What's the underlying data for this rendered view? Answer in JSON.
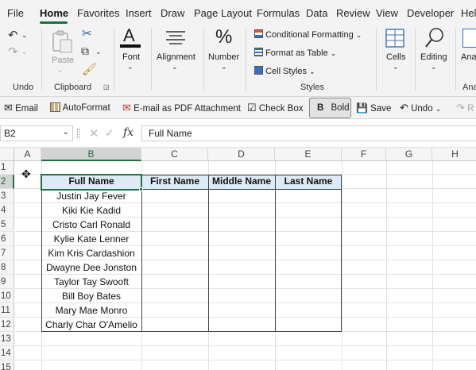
{
  "menu": {
    "tabs": [
      "File",
      "Home",
      "Favorites",
      "Insert",
      "Draw",
      "Page Layout",
      "Formulas",
      "Data",
      "Review",
      "View",
      "Developer",
      "Help"
    ]
  },
  "ribbon": {
    "undo_group": "Undo",
    "clipboard_group": "Clipboard",
    "paste_label": "Paste",
    "font_label": "Font",
    "alignment_label": "Alignment",
    "number_label": "Number",
    "conditional_formatting": "Conditional Formatting",
    "format_as_table": "Format as Table",
    "cell_styles": "Cell Styles",
    "styles_group": "Styles",
    "cells_label": "Cells",
    "editing_label": "Editing",
    "analyze_label": "Anal",
    "analyze_group": "Ana"
  },
  "qat": {
    "email": "Email",
    "autoformat": "AutoFormat",
    "email_pdf": "E-mail as PDF Attachment",
    "check_box": "Check Box",
    "bold": "Bold",
    "save": "Save",
    "undo": "Undo",
    "redo": "R"
  },
  "formula_bar": {
    "name_box": "B2",
    "fx": "fx",
    "value": "Full Name"
  },
  "columns": [
    "A",
    "B",
    "C",
    "D",
    "E",
    "F",
    "G",
    "H"
  ],
  "rows": [
    "1",
    "2",
    "3",
    "4",
    "5",
    "6",
    "7",
    "8",
    "9",
    "10",
    "11",
    "12",
    "13",
    "14",
    "15"
  ],
  "table": {
    "headers": [
      "Full Name",
      "First Name",
      "Middle Name",
      "Last Name"
    ],
    "full_names": [
      "Justin Jay Fever",
      "Kiki Kie Kadid",
      "Cristo Carl Ronald",
      "Kylie Kate Lenner",
      "Kim Kris Cardashion",
      "Dwayne Dee Jonston",
      "Taylor Tay Swooft",
      "Bill Boy Bates",
      "Mary Mae Monro",
      "Charly Char O'Amelio"
    ]
  },
  "colors": {
    "accent": "#217346",
    "header_fill": "#ddebf7"
  }
}
